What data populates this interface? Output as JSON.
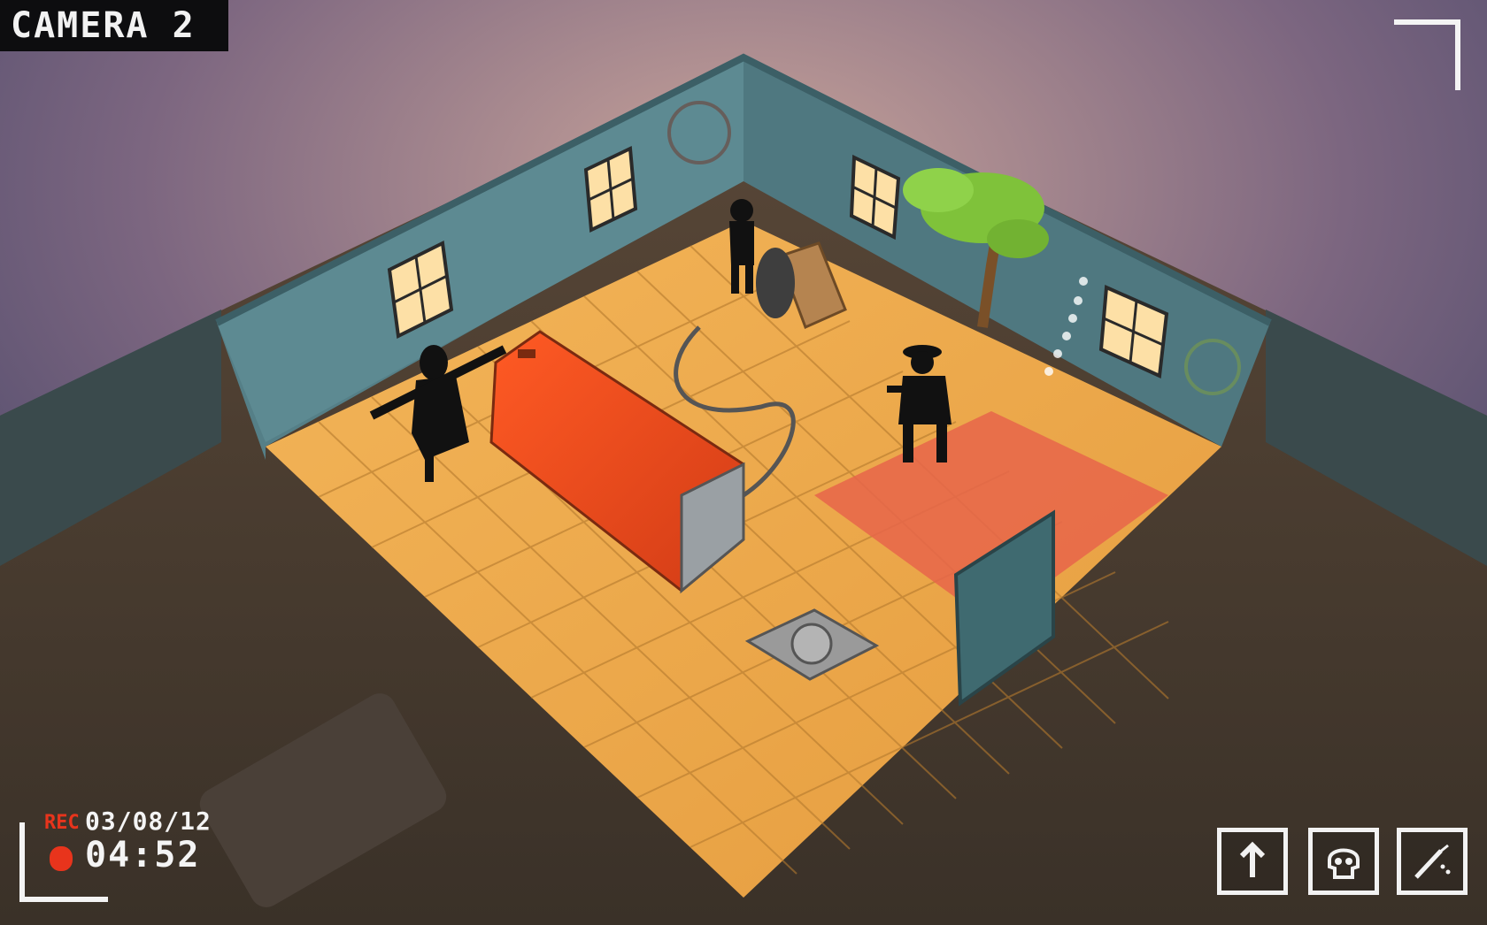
{
  "hud": {
    "camera_label": "CAMERA 2",
    "rec_label": "REC",
    "rec_date": "03/08/12",
    "rec_time": "04:52"
  },
  "actions": [
    {
      "name": "move-up",
      "icon": "arrow-up-icon"
    },
    {
      "name": "skull",
      "icon": "skull-icon"
    },
    {
      "name": "knife",
      "icon": "knife-icon"
    }
  ],
  "colors": {
    "rec_red": "#e8341c",
    "hud_white": "#f4f4f4",
    "wall_teal": "#4c7a82",
    "floor_orange": "#efa94c",
    "generator_red": "#e8461c"
  }
}
